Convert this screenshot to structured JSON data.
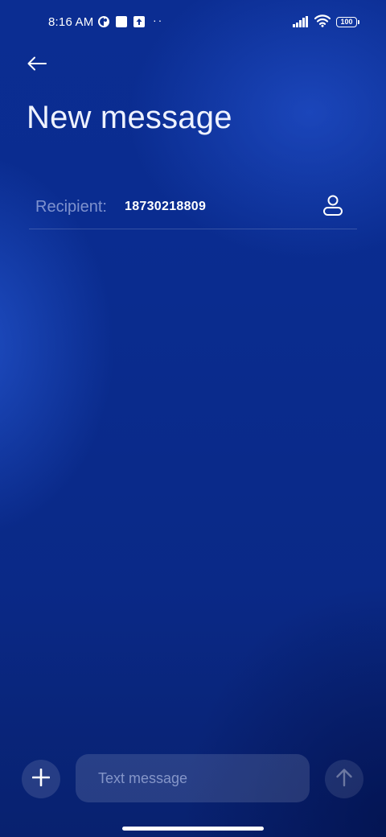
{
  "status_bar": {
    "time": "8:16 AM",
    "dots": "··",
    "battery": "100",
    "icons": [
      "cloud-sync-icon",
      "square-notification-icon",
      "upload-icon",
      "signal-icon",
      "wifi-icon",
      "battery-icon"
    ]
  },
  "header": {
    "back_icon": "back-arrow-icon",
    "title": "New message"
  },
  "recipient": {
    "label": "Recipient:",
    "value": "18730218809",
    "contact_icon": "contact-person-icon"
  },
  "compose": {
    "attach_icon": "plus-icon",
    "placeholder": "Text message",
    "send_icon": "send-arrow-up-icon"
  },
  "colors": {
    "background": "#0a2a8c",
    "text": "#ffffff"
  }
}
